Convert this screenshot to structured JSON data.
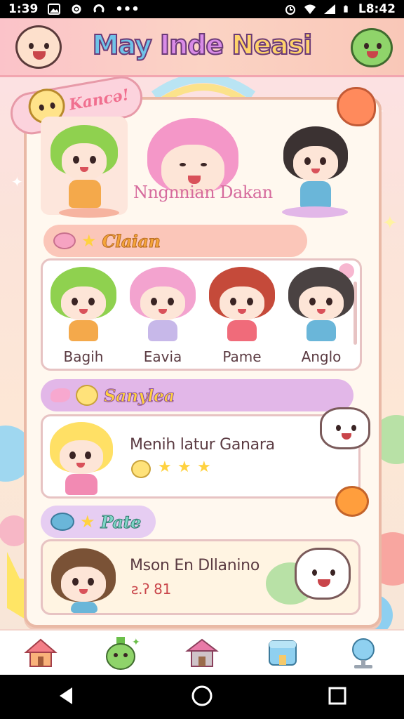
{
  "status_bar": {
    "time": "1:39",
    "clock_right": "L8:42",
    "icons_left": [
      "gallery-icon",
      "settings-icon",
      "sync-icon",
      "more-icon"
    ],
    "icons_right": [
      "alarm-icon",
      "wifi-icon",
      "signal-icon",
      "battery-icon"
    ]
  },
  "header": {
    "title_words": [
      "May",
      "Inde",
      "Neasi"
    ],
    "left_avatar": "baby-face-icon",
    "right_avatar": "frog-face-icon"
  },
  "hero": {
    "badge_label": "Kancə!",
    "featured_name": "Nngnnian Dakan"
  },
  "section_class": {
    "label": "Claian",
    "characters": [
      {
        "name": "Bagih",
        "hair": "#8fd14f",
        "shirt": "#f4a94b"
      },
      {
        "name": "Eavia",
        "hair": "#f3a3cf",
        "shirt": "#c7b8e9"
      },
      {
        "name": "Pame",
        "hair": "#c54a3a",
        "shirt": "#f06b7a"
      },
      {
        "name": "Anglo",
        "hair": "#4a4242",
        "shirt": "#6ab6d9"
      }
    ]
  },
  "section_sample": {
    "label": "Sanylea",
    "item_title": "Menih latur Ganara",
    "stars": 3
  },
  "section_pate": {
    "label": "Pate",
    "item_title": "Mson En Dllanino",
    "meta": "ƨ.ʔ 81"
  },
  "bottom_nav": [
    "home-icon",
    "bottle-pet-icon",
    "house-icon",
    "box-icon",
    "globe-icon"
  ],
  "colors": {
    "accent_pink": "#f06f8f",
    "header_bg": "#fbc3c9",
    "panel_bg": "#fff8ef",
    "sample_pill": "#e2b7e8",
    "class_pill": "#fbc6b9",
    "pate_pill": "#e6cdf2"
  }
}
